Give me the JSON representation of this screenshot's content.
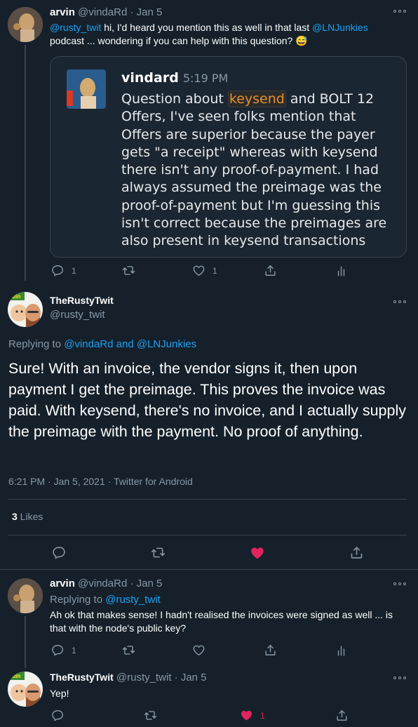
{
  "tweet1": {
    "name": "arvin",
    "handle": "@vindaRd",
    "sep": "·",
    "date": "Jan 5",
    "mention1": "@rusty_twit",
    "text1": " hi, I'd heard you mention this as well in that last ",
    "mention2": "@LNJunkies",
    "text2": "podcast ... wondering if you can help with this question? ",
    "emoji": "😅",
    "quoted": {
      "name": "vindard",
      "time": "5:19 PM",
      "pre": "Question about ",
      "code": "keysend",
      "post": " and BOLT 12 Offers, I've seen folks mention that Offers are superior because the payer gets \"a receipt\" whereas with keysend there isn't any proof-of-payment. I had always assumed the preimage was the proof-of-payment but I'm guessing this isn't correct because the preimages are also present in keysend transactions"
    },
    "reply_count": "1",
    "like_count": "1"
  },
  "main": {
    "name": "TheRustyTwit",
    "handle": "@rusty_twit",
    "replying_label": "Replying to ",
    "replying_to1": "@vindaRd",
    "replying_and": " and ",
    "replying_to2": "@LNJunkies",
    "text": "Sure! With an invoice, the vendor signs it, then upon payment I get the preimage. This proves the invoice was paid. With keysend, there's no invoice, and I actually supply the preimage with the payment. No proof of anything.",
    "meta": "6:21 PM · Jan 5, 2021 · Twitter for Android",
    "likes_count": "3",
    "likes_label": " Likes",
    "liked": true
  },
  "reply1": {
    "name": "arvin",
    "handle": "@vindaRd",
    "sep": "·",
    "date": "Jan 5",
    "replying_label": "Replying to ",
    "replying_to": "@rusty_twit",
    "text": "Ah ok that makes sense! I hadn't realised the invoices were signed as well ... is that with the node's public key?",
    "reply_count": "1"
  },
  "reply2": {
    "name": "TheRustyTwit",
    "handle": "@rusty_twit",
    "sep": "·",
    "date": "Jan 5",
    "text": "Yep!",
    "like_count": "1"
  },
  "colors": {
    "background": "#15202b",
    "accent": "#1da1f2",
    "muted": "#8899a6",
    "like": "#e0245e",
    "border": "#38444d"
  },
  "icons": [
    "reply-icon",
    "retweet-icon",
    "like-icon",
    "share-icon",
    "analytics-icon",
    "more-icon"
  ]
}
